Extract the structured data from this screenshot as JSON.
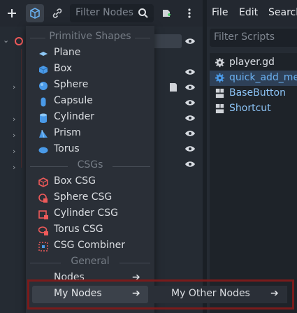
{
  "scene_toolbar": {
    "filter_placeholder": "Filter Nodes",
    "icons": [
      "add-icon",
      "scene-package-icon",
      "link-icon",
      "search-icon",
      "add-script-icon",
      "more-icon"
    ]
  },
  "script_panel": {
    "menu": [
      "File",
      "Edit",
      "Search"
    ],
    "filter_placeholder": "Filter Scripts",
    "items": [
      {
        "label": "player.gd",
        "icon": "gear-icon"
      },
      {
        "label": "quick_add_menu",
        "icon": "gear-icon"
      },
      {
        "label": "BaseButton",
        "icon": "doc-icon"
      },
      {
        "label": "Shortcut",
        "icon": "doc-icon"
      }
    ]
  },
  "popup": {
    "sections": {
      "primitive": "Primitive Shapes",
      "csgs": "CSGs",
      "general": "General"
    },
    "primitive_items": [
      {
        "label": "Plane",
        "icon": "plane-icon"
      },
      {
        "label": "Box",
        "icon": "box-icon"
      },
      {
        "label": "Sphere",
        "icon": "sphere-icon"
      },
      {
        "label": "Capsule",
        "icon": "capsule-icon"
      },
      {
        "label": "Cylinder",
        "icon": "cylinder-icon"
      },
      {
        "label": "Prism",
        "icon": "prism-icon"
      },
      {
        "label": "Torus",
        "icon": "torus-icon"
      }
    ],
    "csg_items": [
      {
        "label": "Box CSG",
        "icon": "csg-box-icon"
      },
      {
        "label": "Sphere CSG",
        "icon": "csg-sphere-icon"
      },
      {
        "label": "Cylinder CSG",
        "icon": "csg-cylinder-icon"
      },
      {
        "label": "Torus CSG",
        "icon": "csg-torus-icon"
      },
      {
        "label": "CSG Combiner",
        "icon": "csg-combiner-icon"
      }
    ],
    "general_items": [
      {
        "label": "Nodes"
      },
      {
        "label": "My Nodes"
      }
    ],
    "submenu_item": "My Other Nodes",
    "arrow": "➔"
  },
  "colors": {
    "accent": "#4a9ae8",
    "csg_red": "#ef5a5a",
    "highlight_frame": "#7a1b1b"
  }
}
